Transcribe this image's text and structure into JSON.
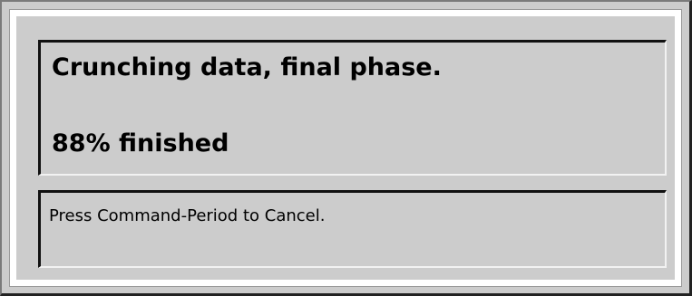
{
  "dialog": {
    "status_message": "Crunching data, final phase.",
    "progress_text": "88% finished",
    "progress_fraction": 0.88,
    "cancel_hint": "Press Command-Period to Cancel."
  }
}
